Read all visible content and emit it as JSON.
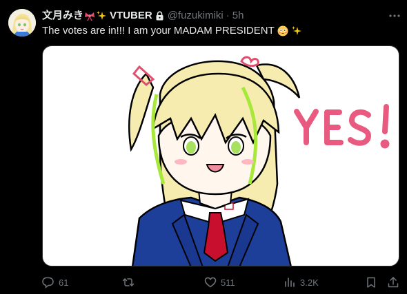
{
  "author": {
    "display_name": "文月みき",
    "suffix": "VTUBER",
    "handle": "@fuzukimiki",
    "separator": "·",
    "time": "5h",
    "verified_lock": true
  },
  "tweet": {
    "text": "The votes are in!!! I am your MADAM PRESIDENT"
  },
  "media": {
    "drawn_text": "YES!",
    "text_color": "#e85a7f"
  },
  "actions": {
    "replies": "61",
    "retweets": "",
    "likes": "511",
    "views": "3.2K"
  },
  "icons": [
    "ribbon-emoji",
    "sparkles-emoji",
    "lock-icon",
    "more-icon",
    "flushed-emoji",
    "reply-icon",
    "retweet-icon",
    "like-icon",
    "views-icon",
    "bookmark-icon",
    "share-icon"
  ],
  "colors": {
    "background": "#000000",
    "text": "#e7e9ea",
    "muted": "#71767b"
  }
}
